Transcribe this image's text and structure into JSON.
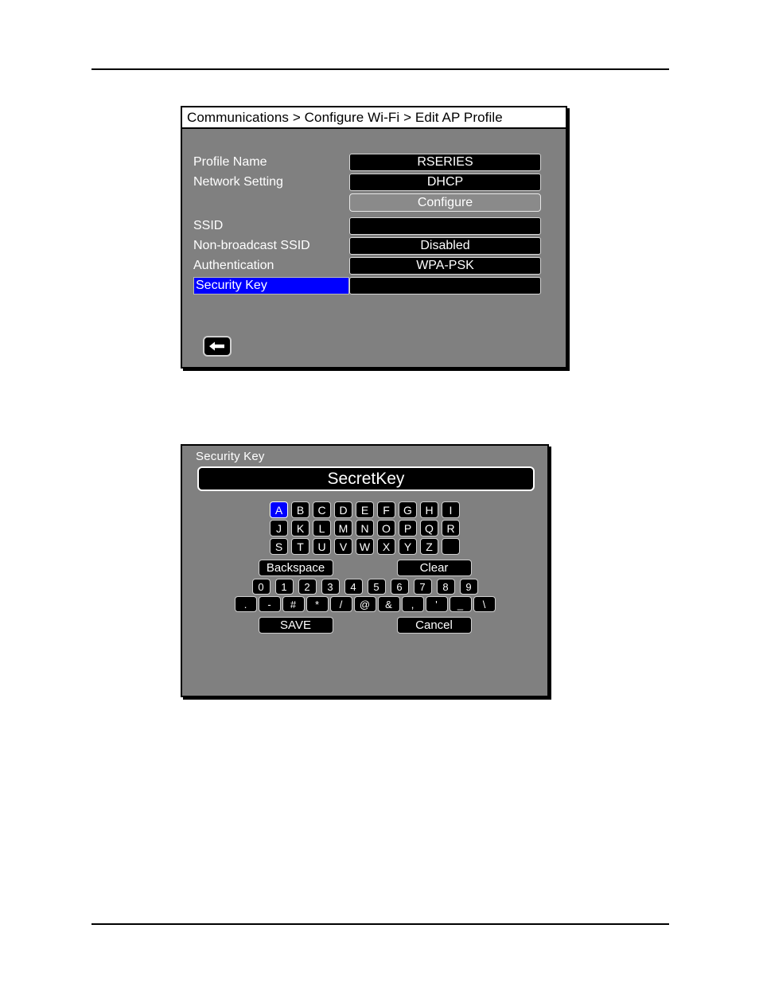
{
  "profile_screen": {
    "breadcrumb": "Communications > Configure Wi-Fi > Edit AP Profile",
    "rows": [
      {
        "label": "Profile Name",
        "value": "RSERIES",
        "selected": false
      },
      {
        "label": "Network Setting",
        "value": "DHCP",
        "selected": false
      },
      {
        "label": "SSID",
        "value": "",
        "selected": false
      },
      {
        "label": "Non-broadcast SSID",
        "value": "Disabled",
        "selected": false
      },
      {
        "label": "Authentication",
        "value": "WPA-PSK",
        "selected": false
      },
      {
        "label": "Security Key",
        "value": "",
        "selected": true
      }
    ],
    "configure_button": "Configure",
    "back_icon": "left-arrow-icon"
  },
  "keypad_screen": {
    "title": "Security Key",
    "value": "SecretKey",
    "selected_key": "A",
    "alpha_rows": [
      [
        "A",
        "B",
        "C",
        "D",
        "E",
        "F",
        "G",
        "H",
        "I"
      ],
      [
        "J",
        "K",
        "L",
        "M",
        "N",
        "O",
        "P",
        "Q",
        "R"
      ],
      [
        "S",
        "T",
        "U",
        "V",
        "W",
        "X",
        "Y",
        "Z",
        " "
      ]
    ],
    "backspace_label": "Backspace",
    "clear_label": "Clear",
    "numbers": [
      "0",
      "1",
      "2",
      "3",
      "4",
      "5",
      "6",
      "7",
      "8",
      "9"
    ],
    "symbols": [
      ".",
      "-",
      "#",
      "*",
      "/",
      "@",
      "&",
      ",",
      "'",
      "_",
      "\\"
    ],
    "save_label": "SAVE",
    "cancel_label": "Cancel"
  },
  "colors": {
    "panel_background": "#808080",
    "field_background": "#000000",
    "highlight": "#0000ff",
    "text": "#ffffff"
  }
}
